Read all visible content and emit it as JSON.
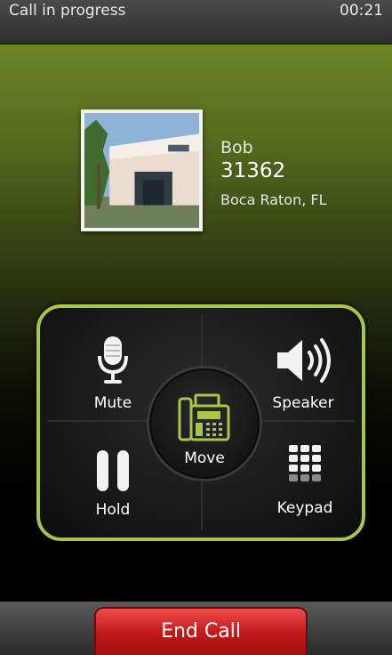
{
  "status_bar": {
    "title": "Call in progress",
    "timer": "00:21"
  },
  "caller": {
    "name": "Bob",
    "number": "31362",
    "location": "Boca Raton, FL"
  },
  "controls": {
    "mute_label": "Mute",
    "speaker_label": "Speaker",
    "hold_label": "Hold",
    "keypad_label": "Keypad",
    "move_label": "Move"
  },
  "end_call_label": "End Call",
  "colors": {
    "accent": "#a7c64a",
    "end_call": "#d32222"
  }
}
